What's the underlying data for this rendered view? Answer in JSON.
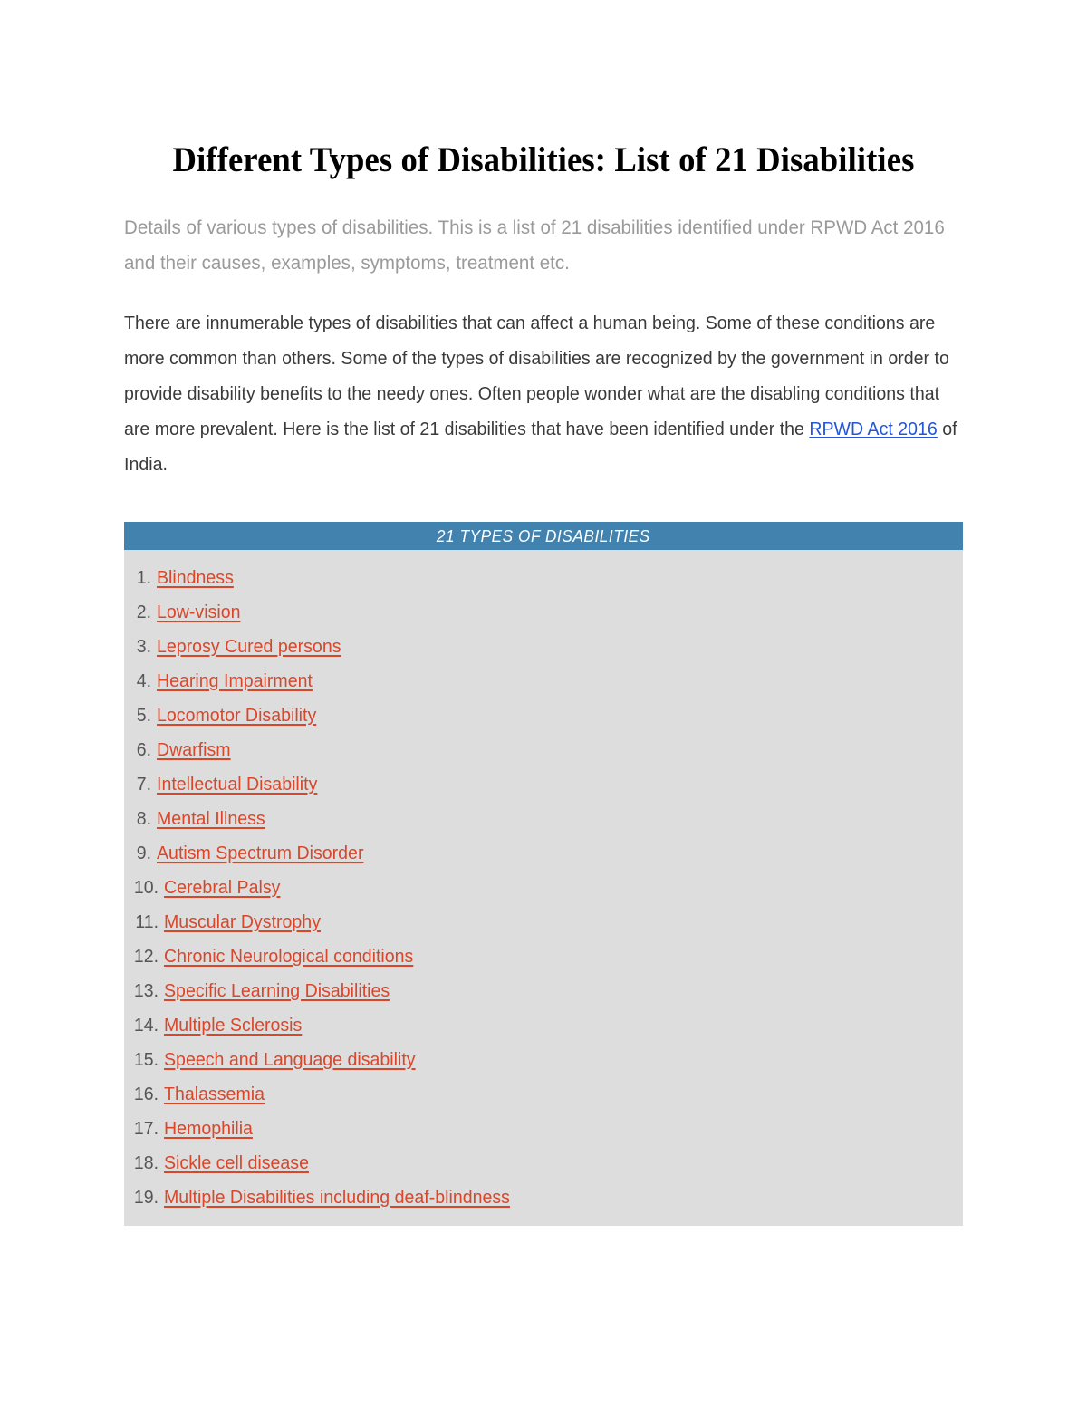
{
  "document": {
    "title": "Different Types of Disabilities: List of 21 Disabilities",
    "subtitle": "Details of various types of disabilities. This is a list of 21 disabilities identified under RPWD Act 2016 and their causes, examples, symptoms, treatment etc.",
    "paragraph": {
      "before_link": "There are innumerable types of disabilities that can affect a human being. Some of these conditions are more common than others. Some of the types of disabilities are recognized by the government in order to provide disability benefits to the needy ones. Often people wonder what are the disabling conditions that are more prevalent. Here is the list of 21 disabilities that have been identified under the ",
      "link_text": "RPWD Act 2016",
      "after_link": " of India."
    }
  },
  "types_box": {
    "header": "21 TYPES OF DISABILITIES",
    "header_bg": "#4183ae",
    "body_bg": "#dddddd",
    "link_color": "#d9472b",
    "items": [
      "Blindness",
      "Low-vision ",
      "Leprosy Cured persons",
      "Hearing Impairment",
      "Locomotor Disability",
      "Dwarfism",
      "Intellectual Disability",
      "Mental Illness",
      "Autism Spectrum Disorder",
      "Cerebral Palsy",
      "Muscular Dystrophy",
      "Chronic Neurological conditions",
      "Specific Learning Disabilities",
      "Multiple Sclerosis",
      "Speech and Language disability",
      "Thalassemia",
      "Hemophilia",
      "Sickle cell disease",
      "Multiple Disabilities including deaf-blindness"
    ]
  },
  "colors": {
    "title_text": "#000000",
    "subtitle_text": "#9a9a9a",
    "body_text": "#3a3a3a",
    "inline_link": "#2356d6",
    "page_background": "#ffffff"
  }
}
